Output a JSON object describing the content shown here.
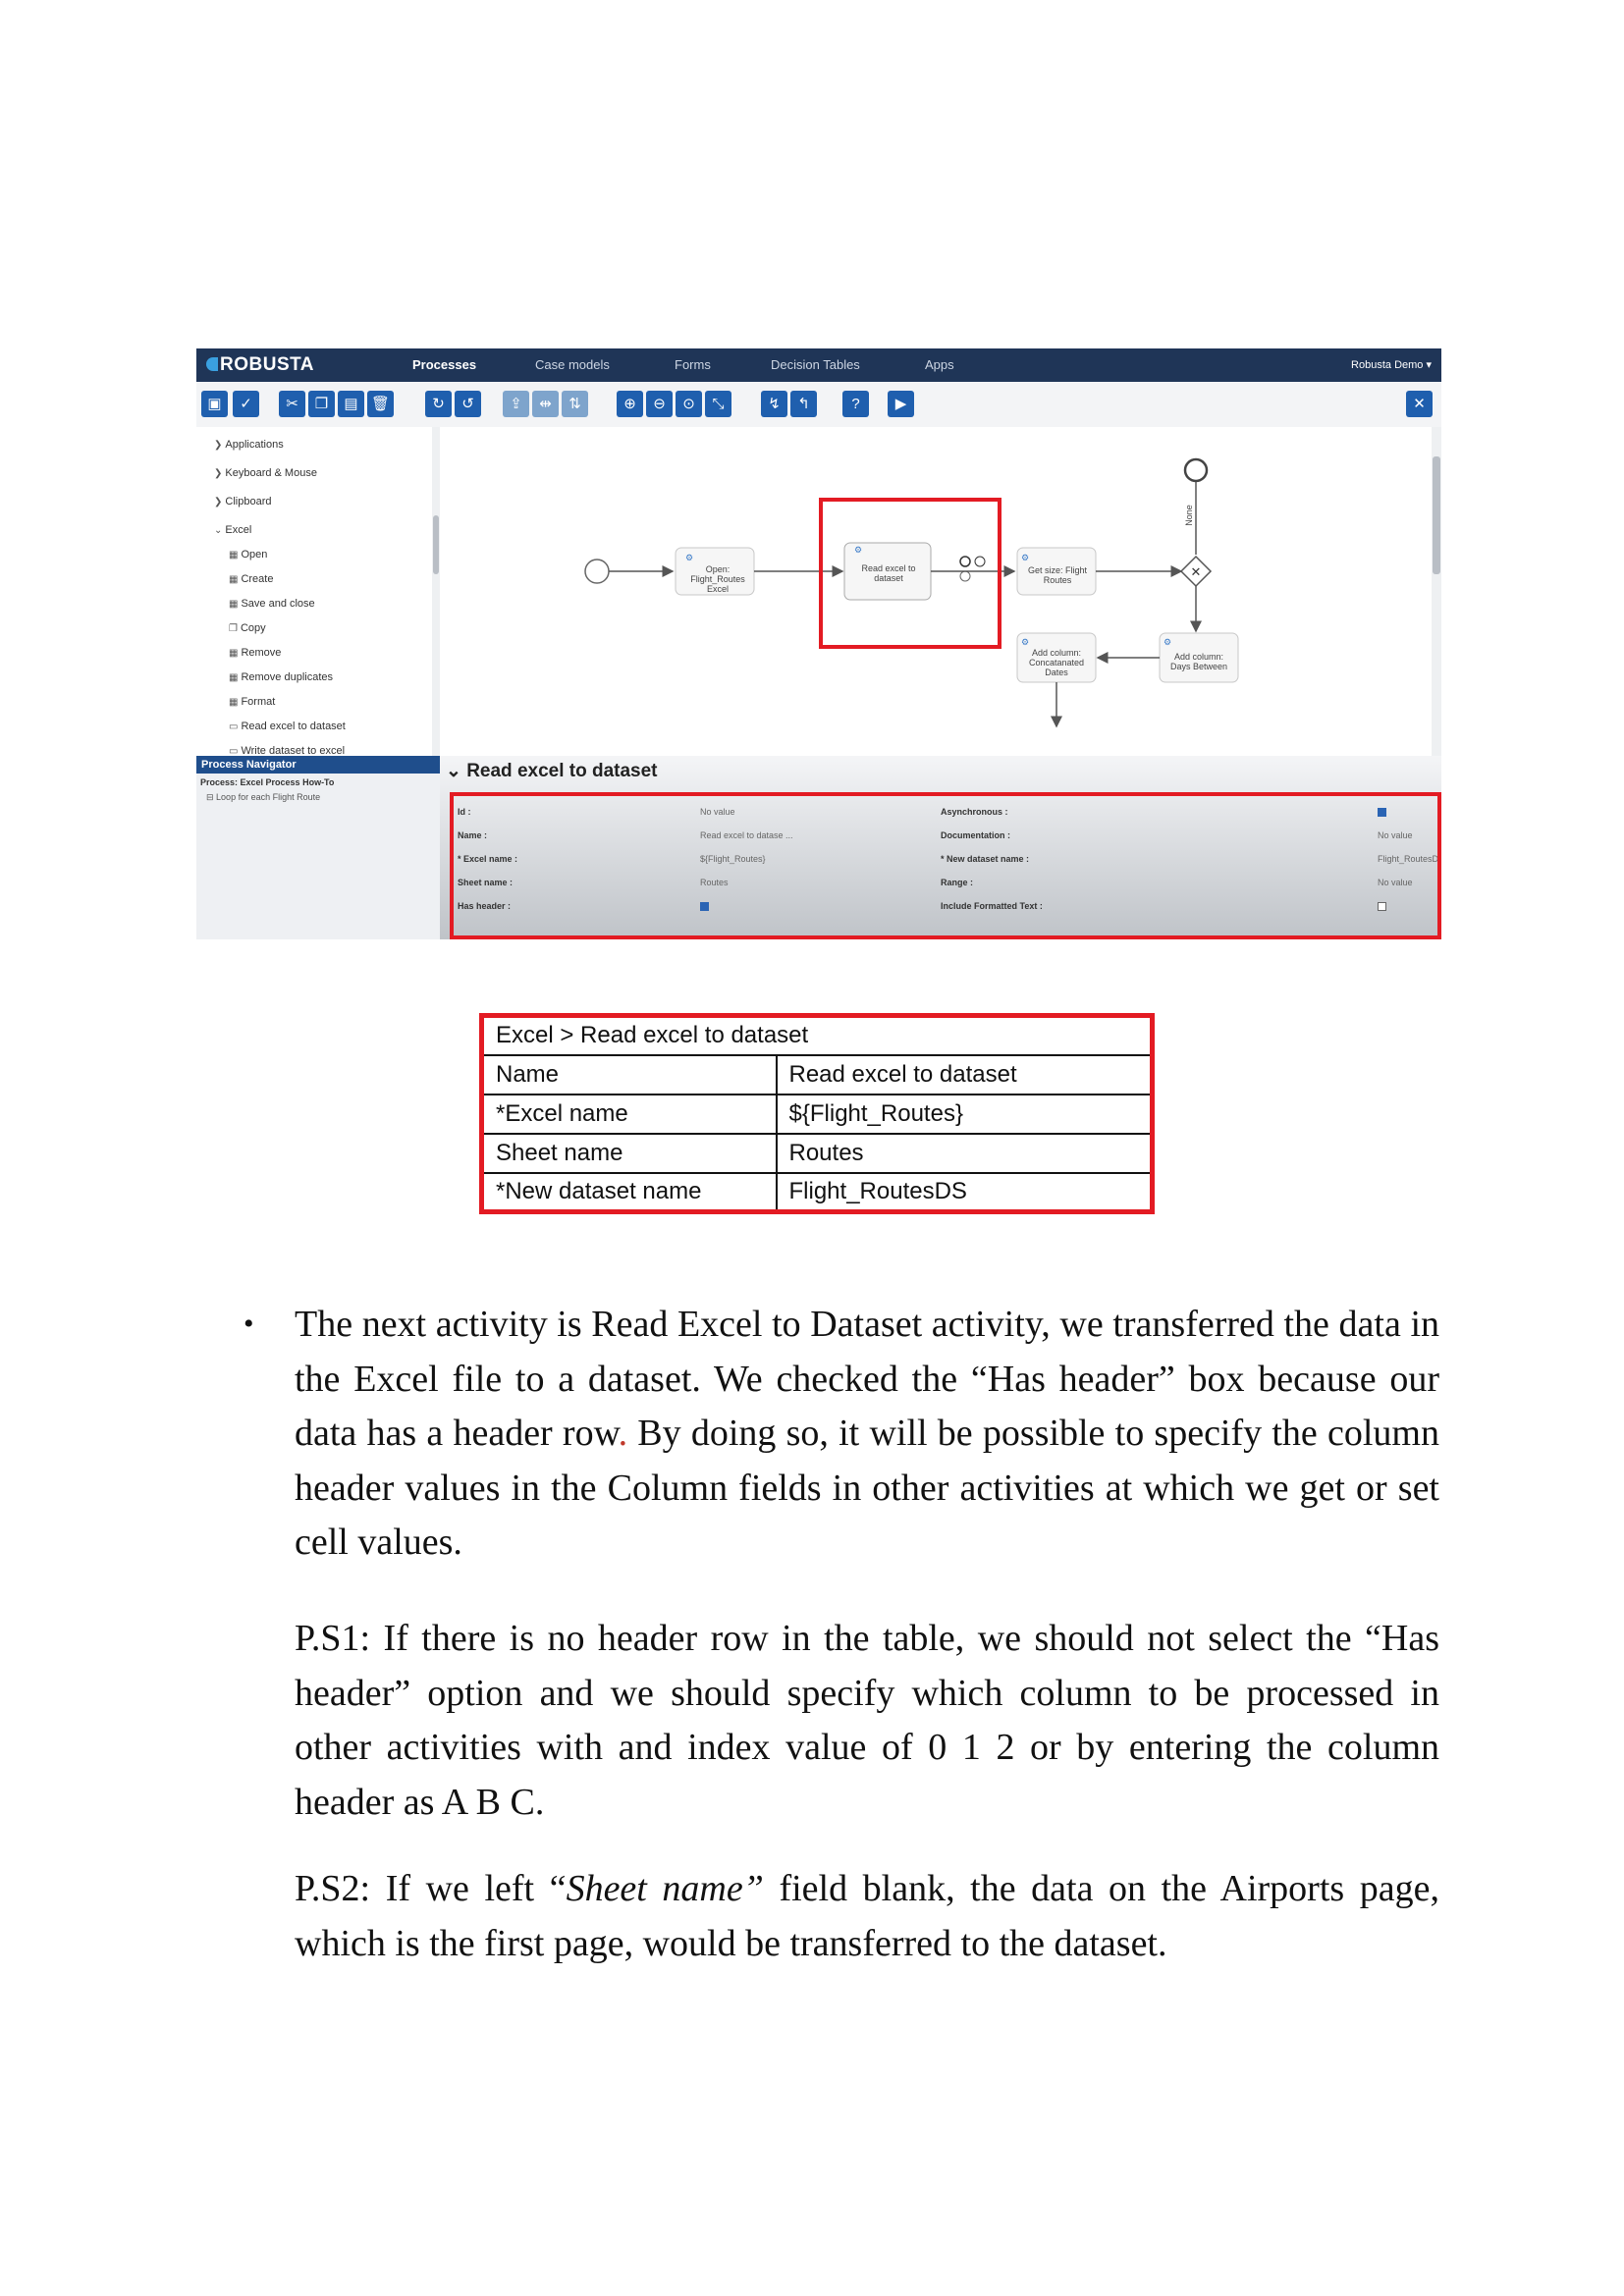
{
  "screenshot": {
    "app": {
      "logo": "ROBUSTA",
      "tabs": [
        "Processes",
        "Case models",
        "Forms",
        "Decision Tables",
        "Apps"
      ],
      "active_tab": "Processes",
      "user_menu": "Robusta Demo ▾"
    },
    "tree": {
      "items": [
        {
          "label": "Applications",
          "icon": "chevron-right-icon"
        },
        {
          "label": "Keyboard & Mouse",
          "icon": "chevron-right-icon"
        },
        {
          "label": "Clipboard",
          "icon": "chevron-right-icon"
        },
        {
          "label": "Excel",
          "icon": "chevron-down-icon"
        },
        {
          "label": "Open",
          "icon": "excel-icon"
        },
        {
          "label": "Create",
          "icon": "excel-icon"
        },
        {
          "label": "Save and close",
          "icon": "excel-icon"
        },
        {
          "label": "Copy",
          "icon": "copy-icon"
        },
        {
          "label": "Remove",
          "icon": "excel-icon"
        },
        {
          "label": "Remove duplicates",
          "icon": "excel-icon"
        },
        {
          "label": "Format",
          "icon": "excel-icon"
        },
        {
          "label": "Read excel to dataset",
          "icon": "table-icon"
        },
        {
          "label": "Write dataset to excel",
          "icon": "table-icon"
        }
      ]
    },
    "process_navigator": {
      "title": "Process Navigator",
      "process": "Process: Excel Process How-To",
      "item": "Loop for each Flight Route"
    },
    "diagram": {
      "tasks": [
        "Open: Flight_Routes Excel",
        "Read excel to dataset",
        "Get size: Flight Routes",
        "Add column: Concatanated Dates",
        "Add column: Days Between"
      ],
      "gateway_label": "None"
    },
    "properties": {
      "title": "Read excel to dataset",
      "left": [
        {
          "label": "Id :",
          "value": "No value"
        },
        {
          "label": "Name :",
          "value": "Read excel to datase ..."
        },
        {
          "label": "* Excel name :",
          "value": "${Flight_Routes}"
        },
        {
          "label": "Sheet name :",
          "value": "Routes"
        },
        {
          "label": "Has header :",
          "value": ""
        }
      ],
      "right": [
        {
          "label": "Asynchronous :",
          "value": ""
        },
        {
          "label": "Documentation :",
          "value": "No value"
        },
        {
          "label": "* New dataset name :",
          "value": "Flight_RoutesDS"
        },
        {
          "label": "Range :",
          "value": "No value"
        },
        {
          "label": "Include Formatted Text :",
          "value": ""
        }
      ],
      "has_header_checked": true,
      "asynchronous_checked": true,
      "include_formatted_text_checked": false
    }
  },
  "summary_table": {
    "header": "Excel  > Read excel to dataset",
    "rows": [
      [
        "Name",
        "Read excel to dataset"
      ],
      [
        "*Excel name",
        "${Flight_Routes}"
      ],
      [
        "Sheet name",
        "Routes"
      ],
      [
        "*New dataset name",
        "Flight_RoutesDS"
      ]
    ]
  },
  "text": {
    "bullet_1a": "The next activity is Read Excel to Dataset activity, we transferred the data in the Excel file to a dataset. We checked the “Has header” box because our data has a header row",
    "bullet_1_period": ".",
    "bullet_1b": " By doing so, it will be possible to specify the column header values in the Column fields in other activities at which we get or set cell values.",
    "ps1": "P.S1: If there is no header row in the table, we should not select the “Has header” option and we should specify which column to be processed in other activities with and index value of 0 1 2 or by entering the column header as A B C.",
    "ps2_a": "P.S2: If we left “",
    "ps2_em": "Sheet name”",
    "ps2_b": " field blank, the data on the Airports page, which is the first page, would be transferred to the dataset."
  },
  "colors": {
    "highlight": "#e31b23",
    "nav": "#1f3557",
    "accent": "#1f5fae"
  }
}
